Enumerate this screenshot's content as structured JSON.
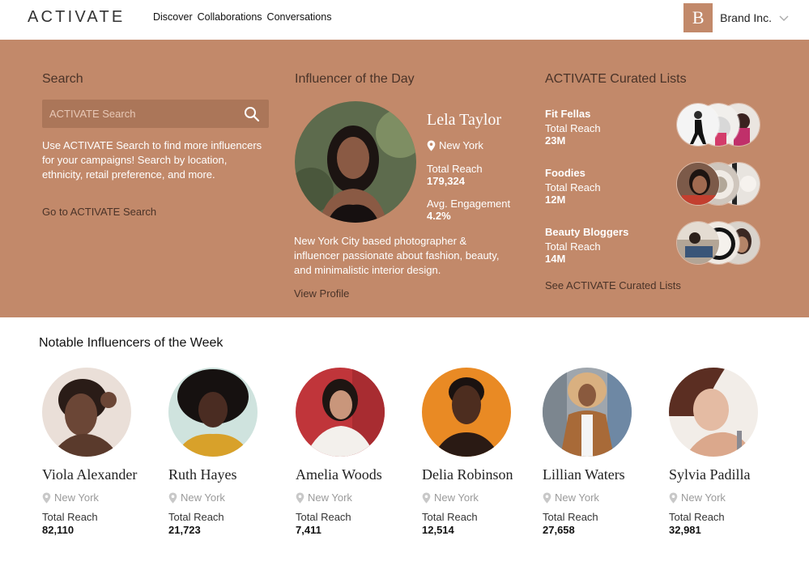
{
  "nav": {
    "logo": "ACTIVATE",
    "links": [
      "Discover",
      "Collaborations",
      "Conversations"
    ],
    "brand_initial": "B",
    "brand_name": "Brand Inc."
  },
  "colors": {
    "accent": "#c2896a",
    "accent_dark_text": "#4a3328"
  },
  "search": {
    "title": "Search",
    "placeholder": "ACTIVATE Search",
    "description": "Use ACTIVATE Search to find more influencers for your campaigns! Search by location, ethnicity, retail preference, and more.",
    "link": "Go to ACTIVATE Search"
  },
  "influencer_of_day": {
    "title": "Influencer of the Day",
    "name": "Lela Taylor",
    "location": "New York",
    "reach_label": "Total Reach",
    "reach_value": "179,324",
    "engagement_label": "Avg. Engagement",
    "engagement_value": "4.2%",
    "description": "New York City based photographer & influencer passionate about fashion, beauty, and minimalistic interior design.",
    "link": "View Profile"
  },
  "curated": {
    "title": "ACTIVATE Curated Lists",
    "lists": [
      {
        "name": "Fit Fellas",
        "reach_label": "Total Reach",
        "reach_value": "23M"
      },
      {
        "name": "Foodies",
        "reach_label": "Total Reach",
        "reach_value": "12M"
      },
      {
        "name": "Beauty Bloggers",
        "reach_label": "Total Reach",
        "reach_value": "14M"
      }
    ],
    "link": "See ACTIVATE Curated Lists"
  },
  "notable": {
    "title": "Notable Influencers of the Week",
    "influencers": [
      {
        "name": "Viola Alexander",
        "location": "New York",
        "reach_label": "Total Reach",
        "reach_value": "82,110"
      },
      {
        "name": "Ruth Hayes",
        "location": "New York",
        "reach_label": "Total Reach",
        "reach_value": "21,723"
      },
      {
        "name": "Amelia Woods",
        "location": "New York",
        "reach_label": "Total Reach",
        "reach_value": "7,411"
      },
      {
        "name": "Delia Robinson",
        "location": "New York",
        "reach_label": "Total Reach",
        "reach_value": "12,514"
      },
      {
        "name": "Lillian Waters",
        "location": "New York",
        "reach_label": "Total Reach",
        "reach_value": "27,658"
      },
      {
        "name": "Sylvia Padilla",
        "location": "New York",
        "reach_label": "Total Reach",
        "reach_value": "32,981"
      }
    ]
  }
}
